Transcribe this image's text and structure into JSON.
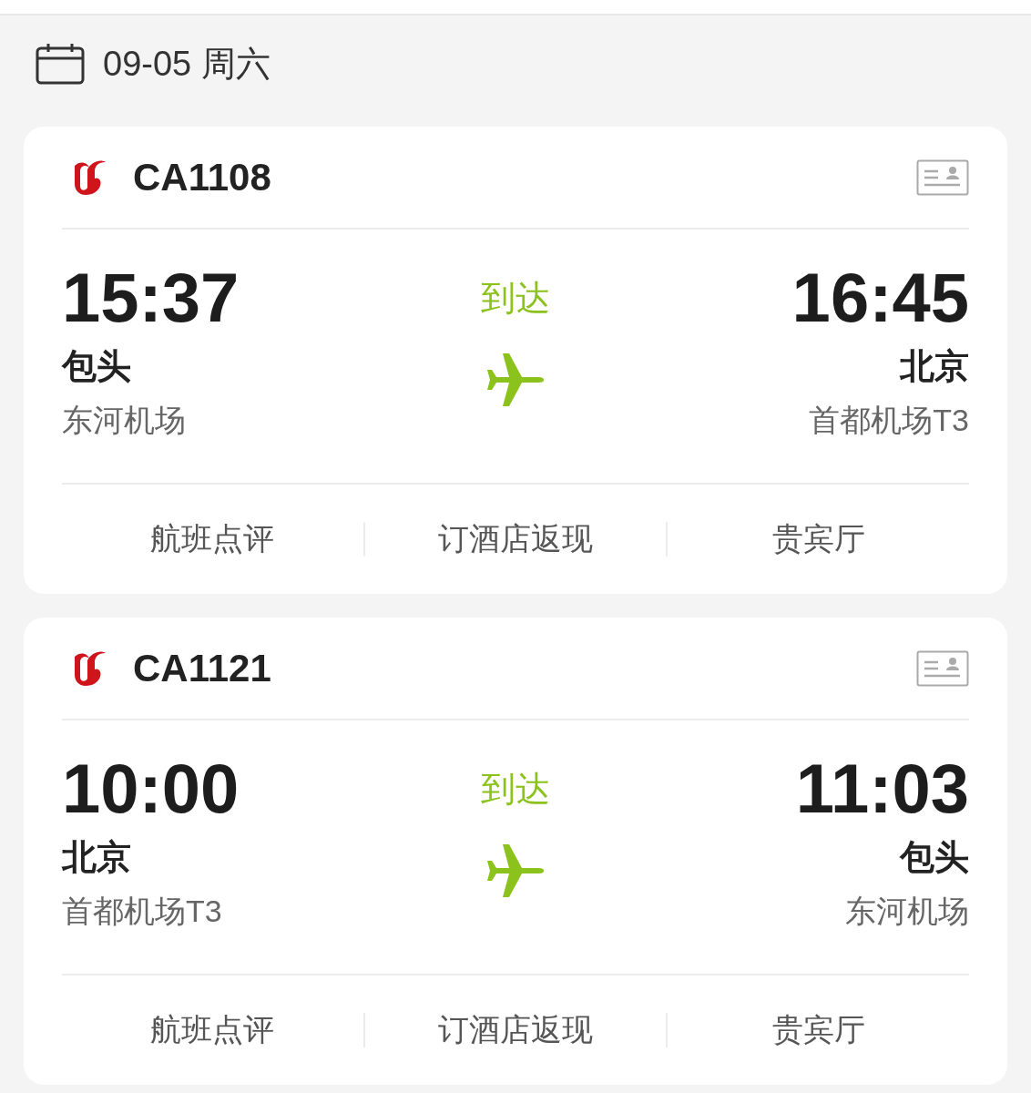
{
  "date": {
    "text": "09-05 周六"
  },
  "flights": [
    {
      "number": "CA1108",
      "status": "到达",
      "depart": {
        "time": "15:37",
        "city": "包头",
        "airport": "东河机场"
      },
      "arrive": {
        "time": "16:45",
        "city": "北京",
        "airport": "首都机场T3"
      },
      "actions": [
        "航班点评",
        "订酒店返现",
        "贵宾厅"
      ]
    },
    {
      "number": "CA1121",
      "status": "到达",
      "depart": {
        "time": "10:00",
        "city": "北京",
        "airport": "首都机场T3"
      },
      "arrive": {
        "time": "11:03",
        "city": "包头",
        "airport": "东河机场"
      },
      "actions": [
        "航班点评",
        "订酒店返现",
        "贵宾厅"
      ]
    }
  ]
}
